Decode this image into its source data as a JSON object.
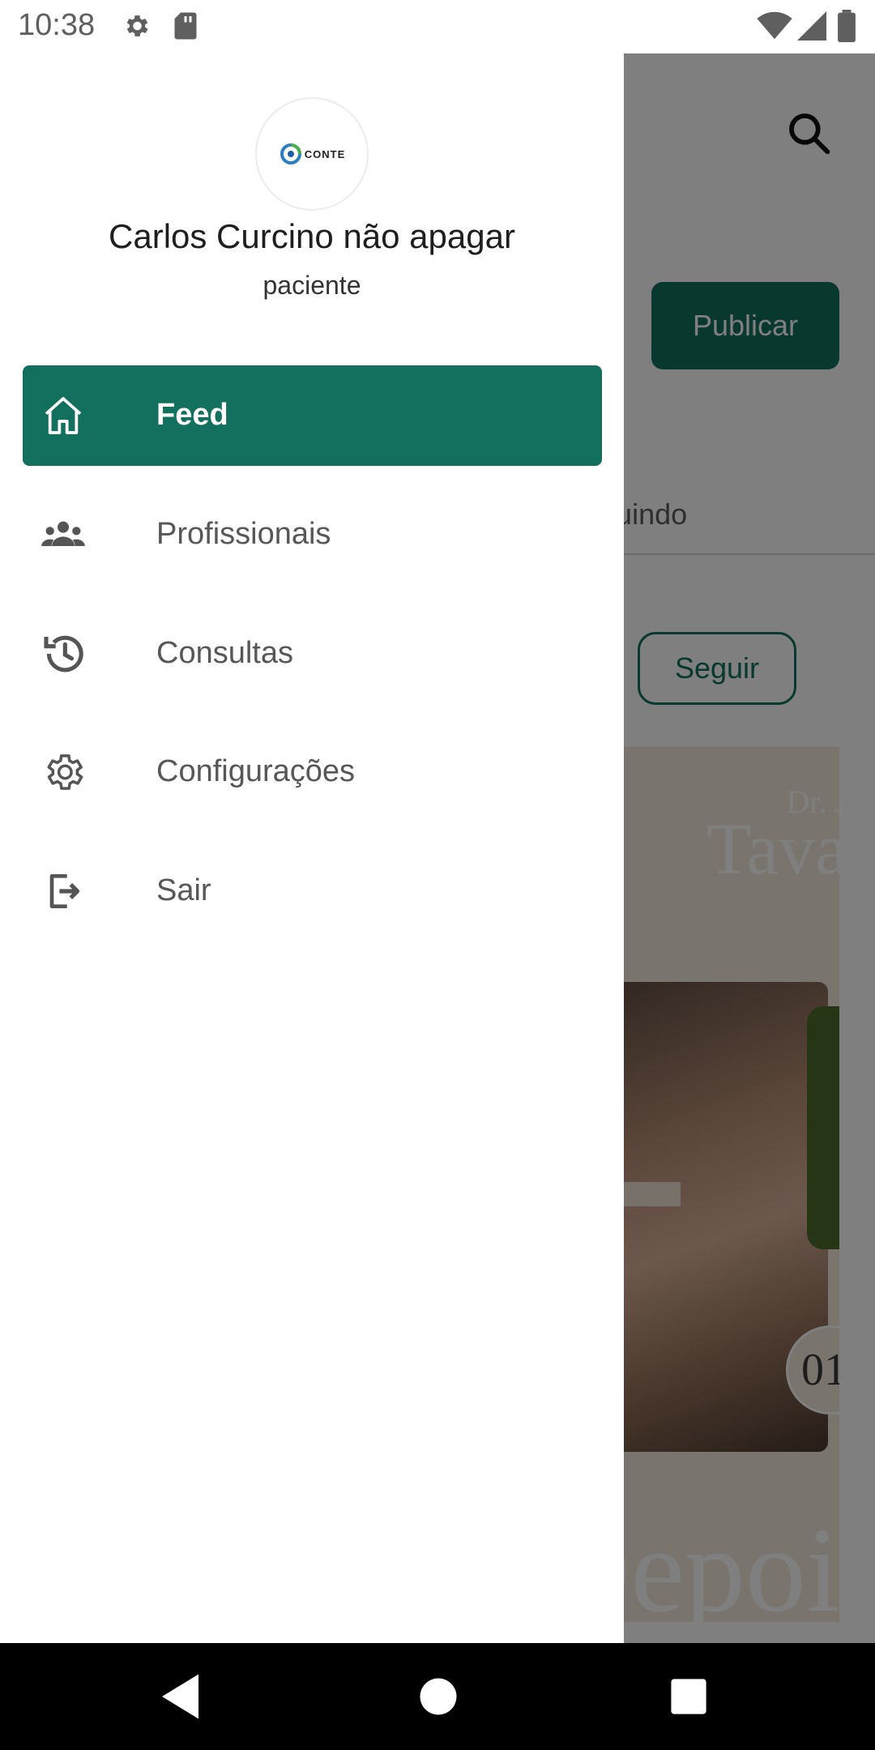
{
  "status_bar": {
    "time": "10:38"
  },
  "feed": {
    "publish_label": "Publicar",
    "tab_following": "eguindo",
    "follow_label": "Seguir",
    "post": {
      "brand_line1": "Dr. J",
      "brand_line2": "Tava",
      "circle_text": "01",
      "caption": "Depois"
    }
  },
  "drawer": {
    "user_name": "Carlos Curcino não apagar",
    "user_role": "paciente",
    "logo_text": "CONTE",
    "items": [
      {
        "label": "Feed",
        "icon": "home-icon",
        "active": true
      },
      {
        "label": "Profissionais",
        "icon": "people-icon",
        "active": false
      },
      {
        "label": "Consultas",
        "icon": "history-icon",
        "active": false
      },
      {
        "label": "Configurações",
        "icon": "gear-icon",
        "active": false
      },
      {
        "label": "Sair",
        "icon": "logout-icon",
        "active": false
      }
    ]
  },
  "colors": {
    "accent": "#13705f",
    "scrim": "rgba(0,0,0,0.5)"
  }
}
